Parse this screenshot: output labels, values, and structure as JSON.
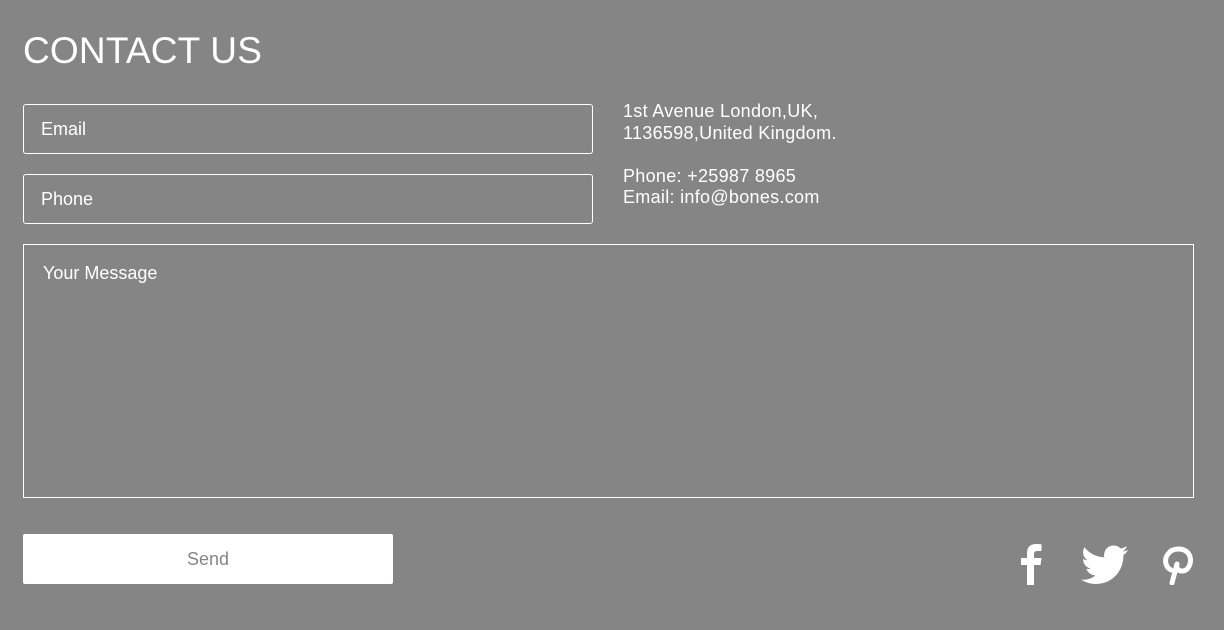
{
  "header": {
    "title": "CONTACT US"
  },
  "form": {
    "email_placeholder": "Email",
    "phone_placeholder": "Phone",
    "message_placeholder": "Your Message",
    "send_label": "Send"
  },
  "contact_info": {
    "address_line_1": "1st Avenue London,UK,",
    "address_line_2": "1136598,United Kingdom.",
    "phone": "Phone: +25987 8965",
    "email": "Email: info@bones.com"
  },
  "social": {
    "items": [
      {
        "icon": "facebook-icon"
      },
      {
        "icon": "twitter-icon"
      },
      {
        "icon": "pinterest-icon"
      }
    ]
  },
  "colors": {
    "background": "#858585",
    "foreground": "#ffffff"
  }
}
